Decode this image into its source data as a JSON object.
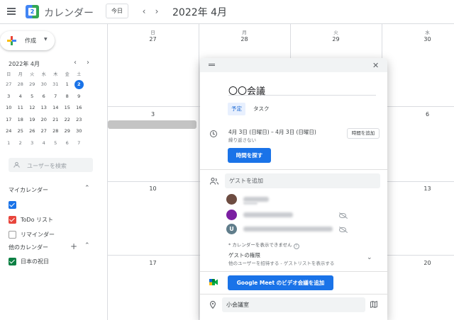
{
  "header": {
    "app_title": "カレンダー",
    "logo_day": "2",
    "today_label": "今日",
    "prev": "‹",
    "next": "›",
    "month_title": "2022年 4月"
  },
  "sidebar": {
    "create_label": "作成",
    "mini_month": "2022年 4月",
    "mini_weekdays": [
      "日",
      "月",
      "火",
      "水",
      "木",
      "金",
      "土"
    ],
    "mini_weeks": [
      [
        "27",
        "28",
        "29",
        "30",
        "31",
        "1",
        "2"
      ],
      [
        "3",
        "4",
        "5",
        "6",
        "7",
        "8",
        "9"
      ],
      [
        "10",
        "11",
        "12",
        "13",
        "14",
        "15",
        "16"
      ],
      [
        "17",
        "18",
        "19",
        "20",
        "21",
        "22",
        "23"
      ],
      [
        "24",
        "25",
        "26",
        "27",
        "28",
        "29",
        "30"
      ],
      [
        "1",
        "2",
        "3",
        "4",
        "5",
        "6",
        "7"
      ]
    ],
    "today_number": "2",
    "search_placeholder": "ユーザーを検索",
    "my_calendars_label": "マイカレンダー",
    "my_calendars": [
      {
        "label": "",
        "color": "#1a73e8",
        "checked": true
      },
      {
        "label": "ToDo リスト",
        "color": "#e8453c",
        "checked": true
      },
      {
        "label": "リマインダー",
        "color": "#9e9e9e",
        "checked": false
      }
    ],
    "other_calendars_label": "他のカレンダー",
    "other_calendars": [
      {
        "label": "日本の祝日",
        "color": "#0b8043",
        "checked": true
      }
    ]
  },
  "main": {
    "columns": [
      {
        "dow": "日",
        "date": "27"
      },
      {
        "dow": "月",
        "date": "28"
      },
      {
        "dow": "火",
        "date": "29"
      },
      {
        "dow": "水",
        "date": "30"
      }
    ],
    "row2": [
      "3",
      "",
      "",
      "6"
    ],
    "row3": [
      "10",
      "",
      "",
      "13"
    ],
    "row4": [
      "17",
      "",
      "",
      "20"
    ]
  },
  "dialog": {
    "title": "〇〇会議",
    "tab_event": "予定",
    "tab_task": "タスク",
    "date_range": "4月 3日 (日曜日)  –  4月 3日 (日曜日)",
    "repeat": "繰り返さない",
    "add_time": "時間を追加",
    "find_time": "時間を探す",
    "guest_placeholder": "ゲストを追加",
    "guest_note": "* カレンダーを表示できません",
    "guest_permissions_title": "ゲストの権限",
    "guest_permissions_sub": "他のユーザーを招待する - ゲストリストを表示する",
    "meet_button": "Google Meet のビデオ会議を追加",
    "location": "小会議室",
    "guests": [
      {
        "avatar_color": "#6d4c41",
        "letter": ""
      },
      {
        "avatar_color": "#7b1fa2",
        "letter": ""
      },
      {
        "avatar_color": "#607d8b",
        "letter": "U"
      }
    ]
  }
}
